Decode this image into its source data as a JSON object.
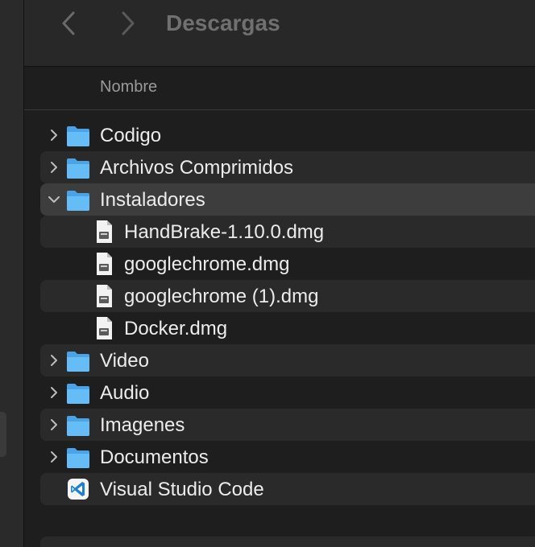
{
  "window": {
    "title": "Descargas"
  },
  "toolbar": {
    "back_icon": "chevron-left-icon",
    "forward_icon": "chevron-right-icon"
  },
  "header": {
    "name_column": "Nombre"
  },
  "rows": [
    {
      "label": "Codigo",
      "kind": "folder",
      "expanded": false
    },
    {
      "label": "Archivos Comprimidos",
      "kind": "folder",
      "expanded": false
    },
    {
      "label": "Instaladores",
      "kind": "folder",
      "expanded": true
    },
    {
      "label": "HandBrake-1.10.0.dmg",
      "kind": "file"
    },
    {
      "label": "googlechrome.dmg",
      "kind": "file"
    },
    {
      "label": "googlechrome (1).dmg",
      "kind": "file"
    },
    {
      "label": "Docker.dmg",
      "kind": "file"
    },
    {
      "label": "Video",
      "kind": "folder",
      "expanded": false
    },
    {
      "label": "Audio",
      "kind": "folder",
      "expanded": false
    },
    {
      "label": "Imagenes",
      "kind": "folder",
      "expanded": false
    },
    {
      "label": "Documentos",
      "kind": "folder",
      "expanded": false
    },
    {
      "label": "Visual Studio Code",
      "kind": "app"
    }
  ],
  "colors": {
    "background": "#1e1e1e",
    "stripe": "#2a2a2a",
    "selected": "#3d3d3d",
    "folder": "#5fb4f0",
    "vscode": "#2a8ad8"
  }
}
